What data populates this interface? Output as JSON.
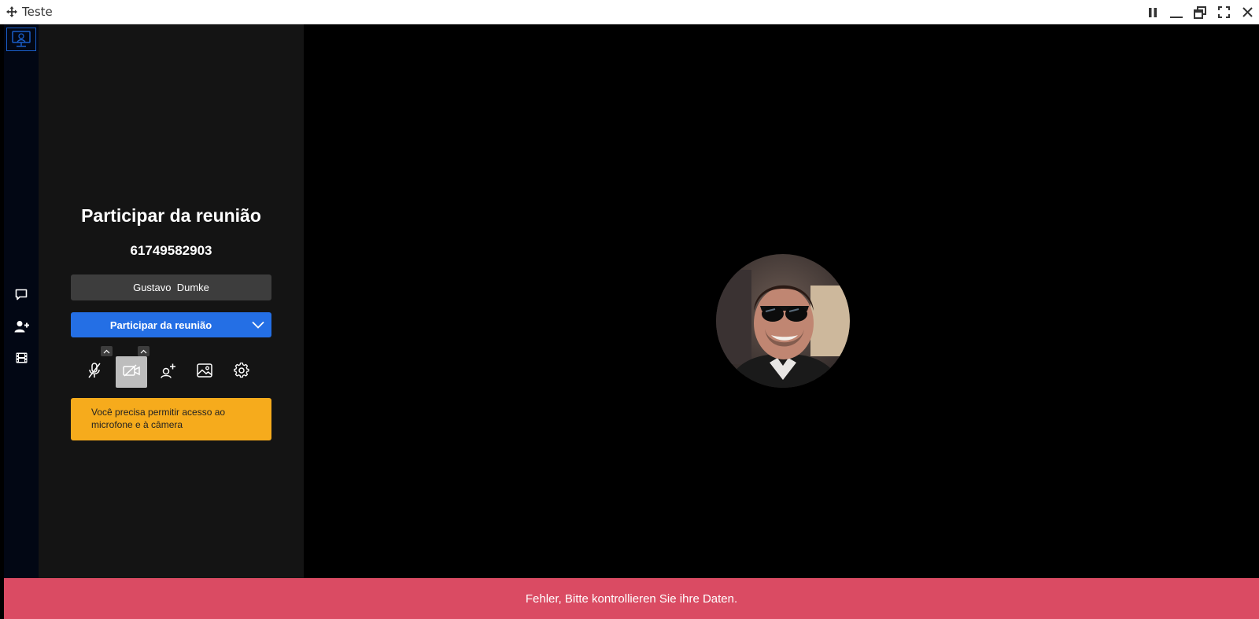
{
  "window": {
    "title": "Teste",
    "icons": [
      "move-icon",
      "pause-icon",
      "minimize-icon",
      "restore-icon",
      "fullscreen-icon",
      "close-icon"
    ]
  },
  "rail": {
    "logo": "computer-logo",
    "items": [
      {
        "icon": "chat-icon"
      },
      {
        "icon": "add-user-icon"
      },
      {
        "icon": "film-icon"
      }
    ]
  },
  "panel": {
    "title": "Participar da reunião",
    "meeting_id": "61749582903",
    "name_value": "Gustavo  Dumke",
    "join_label": "Participar da reunião",
    "tools": [
      "mic-off-icon",
      "camera-off-icon",
      "invite-icon",
      "background-icon",
      "settings-icon"
    ],
    "warning": "Você precisa permitir acesso ao microfone e à câmera"
  },
  "error": {
    "message": "Fehler, Bitte kontrollieren Sie ihre Daten."
  },
  "colors": {
    "primary": "#246fe5",
    "warning": "#f6ab1c",
    "error": "#da4b63",
    "panel": "#141414",
    "rail": "#020714"
  }
}
